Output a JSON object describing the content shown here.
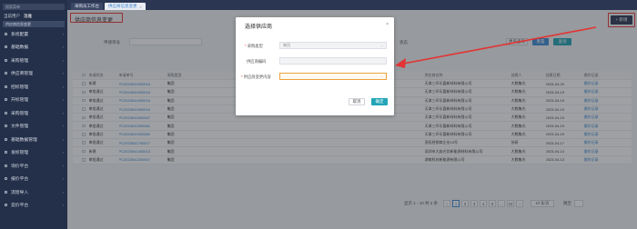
{
  "sidebar": {
    "search_placeholder": "搜索菜单",
    "user_label": "当前用户",
    "user_name": "温雅",
    "submenu_label": "供应商信息变更",
    "items": [
      {
        "label": "系统配置"
      },
      {
        "label": "基础数据"
      },
      {
        "label": "采购管理"
      },
      {
        "label": "供应商管理"
      },
      {
        "label": "招标管理"
      },
      {
        "label": "开标管理"
      },
      {
        "label": "采购管理"
      },
      {
        "label": "文件管理"
      },
      {
        "label": "基础数据管理"
      },
      {
        "label": "发标管理"
      },
      {
        "label": "询价平台"
      },
      {
        "label": "报价平台"
      },
      {
        "label": "流程导入"
      },
      {
        "label": "竞价平台"
      }
    ]
  },
  "tabs": {
    "home": "采购员工作台",
    "current": "供应商信息变更"
  },
  "page": {
    "title": "供应商信息变更",
    "filter_label": "申请单号",
    "filter_label2": "状态",
    "btn_more": "更多查询",
    "btn_reset": "重置",
    "btn_query": "查询",
    "btn_add": "+ 新增"
  },
  "table": {
    "headers": [
      "申请状态",
      "申请单号",
      "采购类型",
      "供应商名称",
      "创建人",
      "创建日期",
      "操作记录"
    ],
    "rows": [
      {
        "status": "新建",
        "no": "PC2023041900016",
        "type": "集团",
        "supplier": "天津三环乐喜新材料有限公司",
        "creator": "大数集光",
        "date": "2023-04-20",
        "op": "操作记录"
      },
      {
        "status": "审批通过",
        "no": "PC2023041900016",
        "type": "集团",
        "supplier": "天津三环乐喜新材料有限公司",
        "creator": "大数集光",
        "date": "2023-04-19",
        "op": "操作记录"
      },
      {
        "status": "审批通过",
        "no": "PC2023041900016",
        "type": "集团",
        "supplier": "天津三环乐喜新材料有限公司",
        "creator": "大数集光",
        "date": "2023-04-19",
        "op": "操作记录"
      },
      {
        "status": "审批通过",
        "no": "PC2023041900016",
        "type": "集团",
        "supplier": "天津三环乐喜新材料有限公司",
        "creator": "大数集光",
        "date": "2023-04-19",
        "op": "操作记录"
      },
      {
        "status": "审批通过",
        "no": "PC2023041900047",
        "type": "集团",
        "supplier": "天津三环乐喜新材料有限公司",
        "creator": "大数集光",
        "date": "2023-04-19",
        "op": "操作记录"
      },
      {
        "status": "审批通过",
        "no": "PC2023041900081",
        "type": "集团",
        "supplier": "天津三环乐喜新材料有限公司",
        "creator": "大数集光",
        "date": "2023-04-19",
        "op": "操作记录"
      },
      {
        "status": "审批通过",
        "no": "PC2023041900081",
        "type": "集团",
        "supplier": "天津三环乐喜新材料有限公司",
        "creator": "大数集光",
        "date": "2023-04-19",
        "op": "操作记录"
      },
      {
        "status": "审批通过",
        "no": "PC2023041700017",
        "type": "集团",
        "supplier": "国氏经销商企业15号",
        "creator": "技研",
        "date": "2023-04-17",
        "op": "操作记录"
      },
      {
        "status": "新建",
        "no": "PC2023041400013",
        "type": "集团",
        "supplier": "深圳市大族光伏新能源材料有限公司",
        "creator": "大数集光",
        "date": "2023-04-14",
        "op": "操作记录"
      },
      {
        "status": "审批通过",
        "no": "PC2023041300007",
        "type": "集团",
        "supplier": "湖南科技新能源有限公司",
        "creator": "大数集光",
        "date": "2023-04-13",
        "op": "操作记录"
      }
    ]
  },
  "pager": {
    "summary": "显示 1 - 10 共 2 条",
    "pages": [
      "‹",
      "1",
      "2",
      "3",
      "4",
      "5",
      "…",
      "22",
      "›"
    ],
    "page_size": "10 条/页",
    "goto": "跳至"
  },
  "dialog": {
    "title": "选择供应商",
    "close": "×",
    "fields": [
      {
        "label": "采购类型",
        "required": true,
        "value": "集团",
        "state": "disabled"
      },
      {
        "label": "供应商编码",
        "required": false,
        "value": "",
        "state": "disabled"
      },
      {
        "label": "供应商变更内容",
        "required": true,
        "value": "",
        "state": "highlight"
      }
    ],
    "cancel": "取消",
    "confirm": "确定"
  },
  "colors": {
    "sidebar_bg": "#243049",
    "accent": "#3d8ad6",
    "annotation_red": "#e33333",
    "link": "#2f7fd2"
  }
}
